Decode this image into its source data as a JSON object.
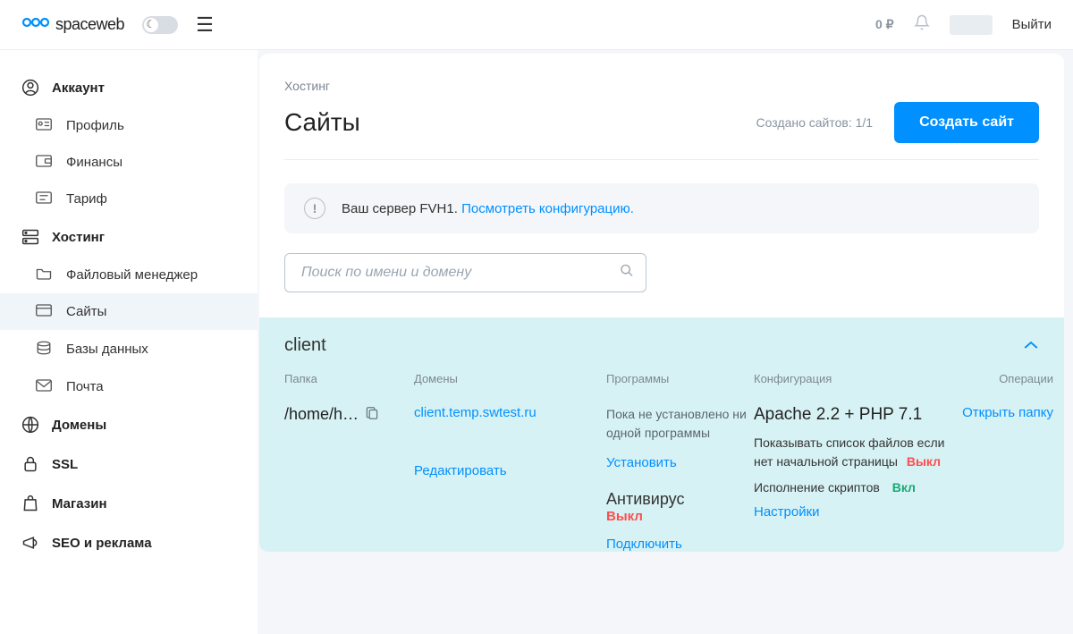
{
  "header": {
    "appName": "spaceweb",
    "balance": "0 ₽",
    "logout": "Выйти"
  },
  "sidebar": {
    "groups": [
      {
        "title": "Аккаунт",
        "items": [
          {
            "label": "Профиль"
          },
          {
            "label": "Финансы"
          },
          {
            "label": "Тариф"
          }
        ]
      },
      {
        "title": "Хостинг",
        "items": [
          {
            "label": "Файловый менеджер"
          },
          {
            "label": "Сайты",
            "active": true
          },
          {
            "label": "Базы данных"
          },
          {
            "label": "Почта"
          }
        ]
      },
      {
        "title": "Домены",
        "items": []
      },
      {
        "title": "SSL",
        "items": []
      },
      {
        "title": "Магазин",
        "items": []
      },
      {
        "title": "SEO и реклама",
        "items": []
      }
    ]
  },
  "main": {
    "breadcrumb": "Хостинг",
    "title": "Сайты",
    "sitesCountLabel": "Создано сайтов: 1/1",
    "createButton": "Создать сайт",
    "notice": {
      "prefix": "Ваш сервер ",
      "server": "FVH1.",
      "linkText": "Посмотреть конфигурацию."
    },
    "searchPlaceholder": "Поиск по имени и домену",
    "site": {
      "name": "client",
      "columns": {
        "folder": "Папка",
        "domains": "Домены",
        "programs": "Программы",
        "configuration": "Конфигурация",
        "operations": "Операции"
      },
      "folderPath": "/home/h…",
      "domain": "client.temp.swtest.ru",
      "editDomain": "Редактировать",
      "programs": {
        "none": "Пока не установлено ни одной программы",
        "install": "Установить",
        "antivirusTitle": "Антивирус",
        "antivirusStatus": "Выкл",
        "connect": "Подключить"
      },
      "config": {
        "title": "Apache 2.2 + PHP 7.1",
        "line1": "Показывать список файлов если нет начальной страницы",
        "line1Status": "Выкл",
        "line2": "Исполнение скриптов",
        "line2Status": "Вкл",
        "settings": "Настройки"
      },
      "operations": {
        "openFolder": "Открыть папку"
      }
    }
  }
}
